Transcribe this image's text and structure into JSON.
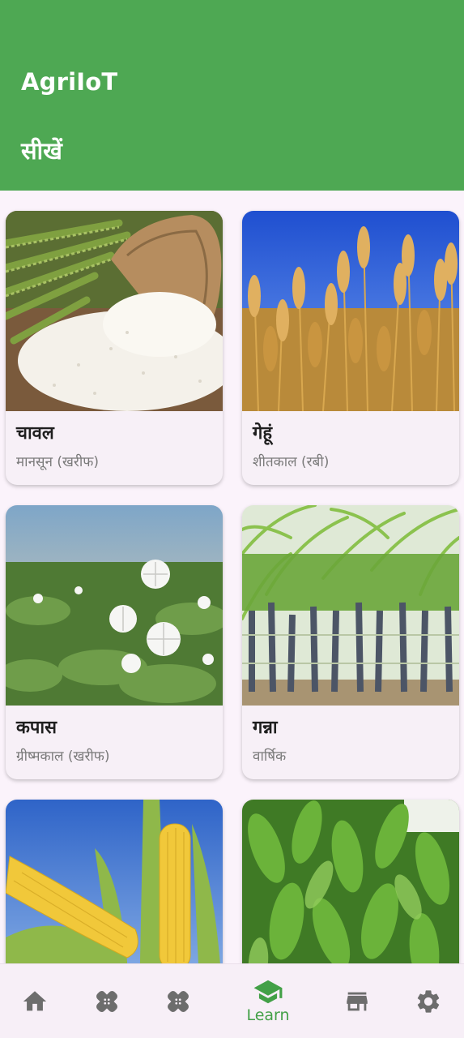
{
  "app_bar": {
    "title": "AgriIoT",
    "page_title": "सीखें",
    "color": "#4ea853"
  },
  "crops": [
    {
      "name": "चावल",
      "season": "मानसून (खरीफ)",
      "image": "rice-photo"
    },
    {
      "name": "गेहूं",
      "season": "शीतकाल (रबी)",
      "image": "wheat-photo"
    },
    {
      "name": "कपास",
      "season": "ग्रीष्मकाल (खरीफ)",
      "image": "cotton-photo"
    },
    {
      "name": "गन्ना",
      "season": "वार्षिक",
      "image": "sugarcane-photo"
    },
    {
      "name": "",
      "season": "",
      "image": "maize-photo"
    },
    {
      "name": "",
      "season": "",
      "image": "tobacco-photo"
    }
  ],
  "bottom_nav": {
    "items": [
      {
        "icon": "home-icon",
        "label": ""
      },
      {
        "icon": "bandage-icon",
        "label": ""
      },
      {
        "icon": "bandage-icon",
        "label": ""
      },
      {
        "icon": "school-icon",
        "label": "Learn",
        "active": true
      },
      {
        "icon": "store-icon",
        "label": ""
      },
      {
        "icon": "gear-icon",
        "label": ""
      }
    ],
    "active_color": "#43a047",
    "inactive_color": "#6d6d6d"
  }
}
